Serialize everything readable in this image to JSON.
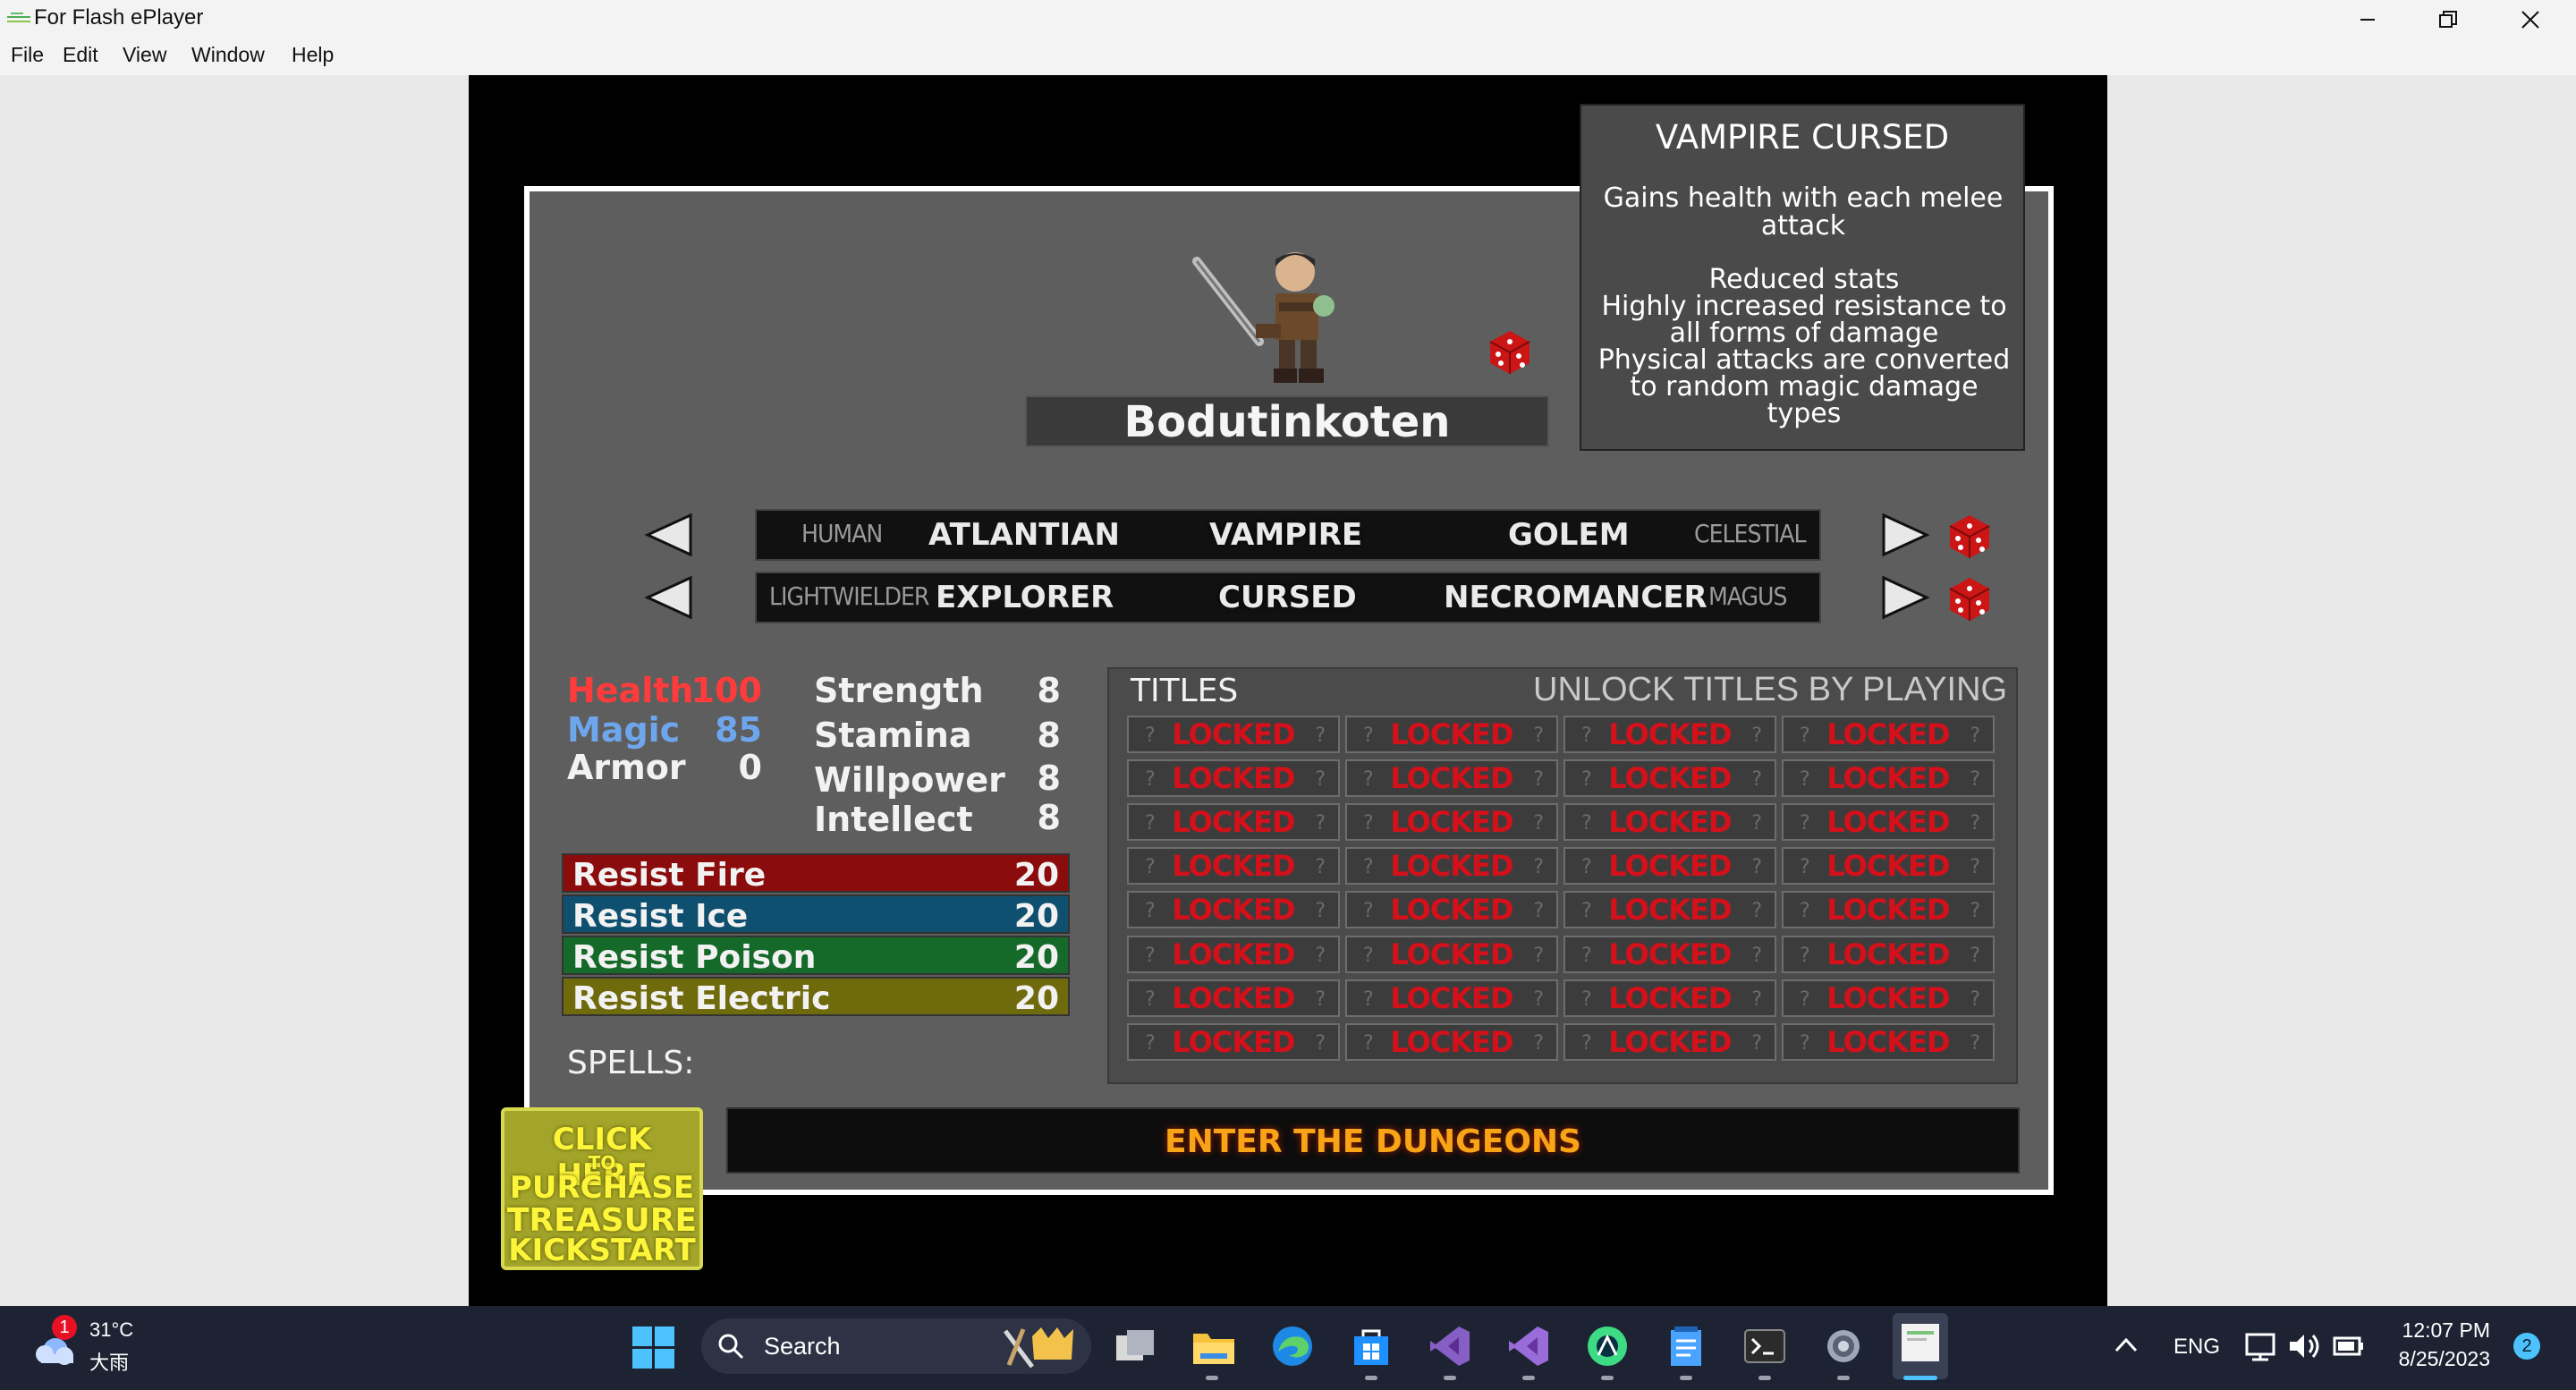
{
  "window": {
    "title": "For Flash ePlayer",
    "controls": [
      "minimize",
      "restore",
      "close"
    ]
  },
  "menu": [
    "File",
    "Edit",
    "View",
    "Window",
    "Help"
  ],
  "tooltip": {
    "title": "VAMPIRE CURSED",
    "description": "Gains health with each melee attack",
    "details": [
      "Reduced stats",
      "Highly increased resistance to",
      "all forms of damage",
      "Physical attacks are converted",
      "to random magic damage",
      "types"
    ]
  },
  "character": {
    "name": "Bodutinkoten"
  },
  "race_selector": {
    "far_left": "HUMAN",
    "left": "ATLANTIAN",
    "selected": "VAMPIRE",
    "right": "GOLEM",
    "far_right": "CELESTIAL"
  },
  "class_selector": {
    "far_left": "LIGHTWIELDER",
    "left": "EXPLORER",
    "selected": "CURSED",
    "right": "NECROMANCER",
    "far_right": "MAGUS"
  },
  "vitals": [
    {
      "label": "Health",
      "value": "100",
      "color": "#ff3b3b"
    },
    {
      "label": "Magic",
      "value": "85",
      "color": "#6ea6ee"
    },
    {
      "label": "Armor",
      "value": "0",
      "color": "#f2f2f2"
    }
  ],
  "attributes": [
    {
      "label": "Strength",
      "value": "8"
    },
    {
      "label": "Stamina",
      "value": "8"
    },
    {
      "label": "Willpower",
      "value": "8"
    },
    {
      "label": "Intellect",
      "value": "8"
    }
  ],
  "resists": [
    {
      "label": "Resist Fire",
      "value": "20",
      "color": "#8a0c0c"
    },
    {
      "label": "Resist Ice",
      "value": "20",
      "color": "#0f4f6f"
    },
    {
      "label": "Resist Poison",
      "value": "20",
      "color": "#156a2a"
    },
    {
      "label": "Resist Electric",
      "value": "20",
      "color": "#6f6a0b"
    }
  ],
  "spells_label": "SPELLS:",
  "titles": {
    "heading": "TITLES",
    "hint": "UNLOCK TITLES BY PLAYING",
    "locked_label": "LOCKED",
    "question_mark": "?",
    "rows": 8,
    "columns": 4
  },
  "kickstart": {
    "line1": "CLICK HERE",
    "line2": "TO",
    "line3": "PURCHASE",
    "line4": "TREASURE",
    "line5": "KICKSTART"
  },
  "enter_button": "ENTER THE DUNGEONS",
  "taskbar": {
    "weather_temp": "31°C",
    "weather_desc": "大雨",
    "weather_badge": "1",
    "search_placeholder": "Search",
    "language": "ENG",
    "time": "12:07 PM",
    "date": "8/25/2023",
    "notification_count": "2",
    "pinned_apps": [
      "task-view",
      "file-explorer",
      "edge",
      "store",
      "visual-studio",
      "visual-studio-preview",
      "android-studio",
      "notepad",
      "terminal",
      "settings",
      "flash-player"
    ]
  }
}
